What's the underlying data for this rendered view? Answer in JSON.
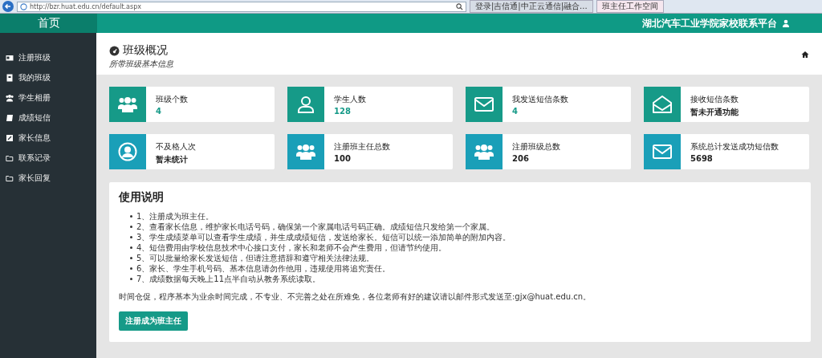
{
  "browser": {
    "url": "http://bzr.huat.edu.cn/default.aspx",
    "tabs": [
      {
        "label": "登录|吉信通|中正云通信|融合...",
        "selected": false
      },
      {
        "label": "班主任工作空间",
        "selected": true
      }
    ]
  },
  "header": {
    "home": "首页",
    "title": "湖北汽车工业学院家校联系平台"
  },
  "sidebar": {
    "items": [
      {
        "label": "注册班级",
        "kind": "card"
      },
      {
        "label": "我的班级",
        "kind": "book"
      },
      {
        "label": "学生相册",
        "kind": "group"
      },
      {
        "label": "成绩短信",
        "kind": "note"
      },
      {
        "label": "家长信息",
        "kind": "edit"
      },
      {
        "label": "联系记录",
        "kind": "folder"
      },
      {
        "label": "家长回复",
        "kind": "folder"
      }
    ]
  },
  "page": {
    "title": "班级概况",
    "subtitle": "所带班级基本信息"
  },
  "stats": [
    {
      "label": "班级个数",
      "value": "4",
      "kind": "group",
      "color": "#169a88",
      "emphasis": true
    },
    {
      "label": "学生人数",
      "value": "128",
      "kind": "user",
      "color": "#169a88",
      "emphasis": true
    },
    {
      "label": "我发送短信条数",
      "value": "4",
      "kind": "mail",
      "color": "#169a88",
      "emphasis": true
    },
    {
      "label": "接收短信条数",
      "value": "暂未开通功能",
      "kind": "mail-open",
      "color": "#169a88",
      "emphasis": false
    },
    {
      "label": "不及格人次",
      "value": "暂未统计",
      "kind": "user-circle",
      "color": "#1a9fb8",
      "emphasis": false
    },
    {
      "label": "注册班主任总数",
      "value": "100",
      "kind": "group",
      "color": "#1a9fb8",
      "emphasis": false
    },
    {
      "label": "注册班级总数",
      "value": "206",
      "kind": "group",
      "color": "#1a9fb8",
      "emphasis": false
    },
    {
      "label": "系统总计发送成功短信数",
      "value": "5698",
      "kind": "mail",
      "color": "#1a9fb8",
      "emphasis": false
    }
  ],
  "instructions": {
    "title": "使用说明",
    "items": [
      "1、注册成为班主任。",
      "2、查看家长信息，维护家长电话号码，确保第一个家属电话号码正确。成绩短信只发给第一个家属。",
      "3、学生成绩菜单可以查看学生成绩，并生成成绩短信，发送给家长。短信可以统一添加简单的附加内容。",
      "4、短信费用由学校信息技术中心接口支付，家长和老师不会产生费用，但请节约使用。",
      "5、可以批量给家长发送短信，但请注意措辞和遵守相关法律法规。",
      "6、家长、学生手机号码、基本信息请勿作他用，违规使用将追究责任。",
      "7、成绩数据每天晚上11点半自动从教务系统读取。"
    ],
    "note": "时间仓促，程序基本为业余时间完成，不专业、不完善之处在所难免，各位老师有好的建议请以邮件形式发送至:gjx@huat.edu.cn。",
    "button": "注册成为班主任"
  }
}
